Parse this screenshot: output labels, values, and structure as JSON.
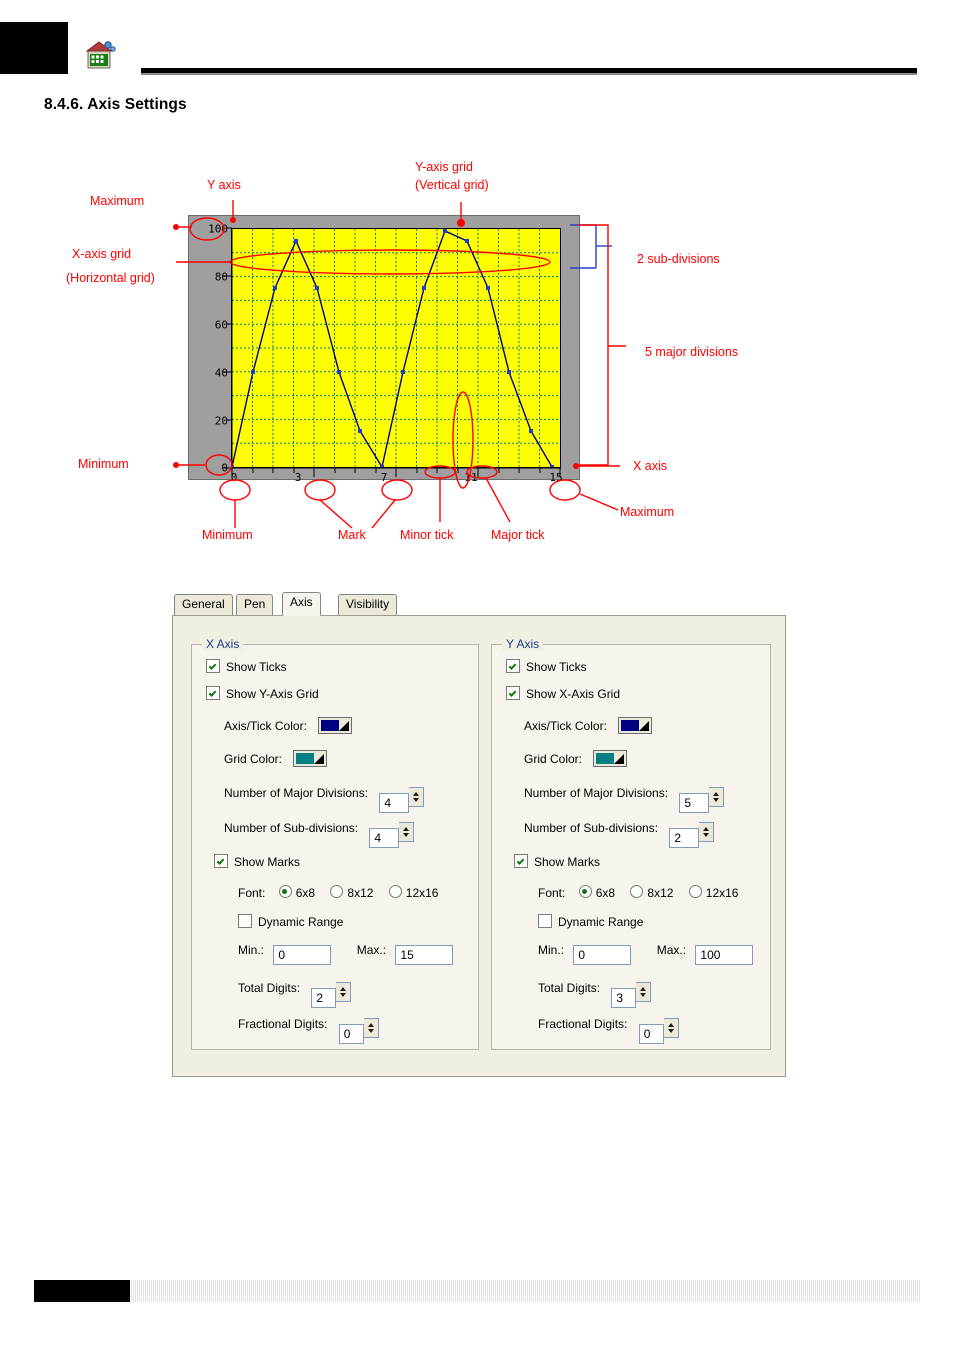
{
  "page": {
    "section_heading": "8.4.6. Axis Settings",
    "header_icon": "app-logo-icon"
  },
  "diagram": {
    "annotations": {
      "maximum_y": "Maximum",
      "minimum_y": "Minimum",
      "y_axis": "Y axis",
      "x_axis": "X axis",
      "maximum_x": "Maximum",
      "minimum_x": "Minimum",
      "x_axis_grid": "X-axis grid\n(Horizontal grid)",
      "x_axis_grid_l1": "X-axis grid",
      "x_axis_grid_l2": "(Horizontal grid)",
      "y_axis_grid_l1": "Y-axis grid",
      "y_axis_grid_l2": "(Vertical grid)",
      "sub_divisions": "2 sub-divisions",
      "major_divisions": "5 major divisions",
      "mark": "Mark",
      "minor_tick": "Minor tick",
      "major_tick": "Major tick"
    },
    "chart_data": {
      "type": "line",
      "title": "",
      "xlabel": "",
      "ylabel": "",
      "y_ticks": [
        "0",
        "20",
        "40",
        "60",
        "80",
        "100"
      ],
      "x_ticks": [
        "0",
        "3",
        "7",
        "11",
        "15"
      ],
      "xlim": [
        0,
        15
      ],
      "ylim": [
        0,
        100
      ],
      "plot_bg_color": "#ffff00",
      "grid_color": "#008080",
      "series_color": "#000080",
      "x": [
        0,
        1,
        2,
        3,
        4,
        5,
        6,
        7,
        8,
        9,
        10,
        11,
        12,
        13,
        14,
        15
      ],
      "values": [
        0,
        40,
        75,
        95,
        75,
        40,
        15,
        0,
        40,
        75,
        100,
        95,
        75,
        40,
        15,
        0
      ]
    }
  },
  "dialog": {
    "tabs": [
      {
        "label": "General",
        "active": false
      },
      {
        "label": "Pen",
        "active": false
      },
      {
        "label": "Axis",
        "active": true
      },
      {
        "label": "Visibility",
        "active": false
      }
    ],
    "x_axis": {
      "group_title": "X Axis",
      "show_ticks_label": "Show Ticks",
      "show_ticks_checked": true,
      "show_grid_label": "Show Y-Axis Grid",
      "show_grid_checked": true,
      "axis_tick_color_label": "Axis/Tick Color:",
      "axis_tick_color": "#000080",
      "grid_color_label": "Grid Color:",
      "grid_color": "#008080",
      "major_divisions_label": "Number of Major Divisions:",
      "major_divisions_value": "4",
      "sub_divisions_label": "Number of Sub-divisions:",
      "sub_divisions_value": "4",
      "show_marks_label": "Show Marks",
      "show_marks_checked": true,
      "font_label": "Font:",
      "font_options": [
        "6x8",
        "8x12",
        "12x16"
      ],
      "font_selected": "6x8",
      "dynamic_range_label": "Dynamic Range",
      "dynamic_range_checked": false,
      "min_label": "Min.:",
      "min_value": "0",
      "max_label": "Max.:",
      "max_value": "15",
      "total_digits_label": "Total Digits:",
      "total_digits_value": "2",
      "fractional_digits_label": "Fractional Digits:",
      "fractional_digits_value": "0"
    },
    "y_axis": {
      "group_title": "Y Axis",
      "show_ticks_label": "Show Ticks",
      "show_ticks_checked": true,
      "show_grid_label": "Show X-Axis Grid",
      "show_grid_checked": true,
      "axis_tick_color_label": "Axis/Tick Color:",
      "axis_tick_color": "#000080",
      "grid_color_label": "Grid Color:",
      "grid_color": "#008080",
      "major_divisions_label": "Number of Major Divisions:",
      "major_divisions_value": "5",
      "sub_divisions_label": "Number of Sub-divisions:",
      "sub_divisions_value": "2",
      "show_marks_label": "Show Marks",
      "show_marks_checked": true,
      "font_label": "Font:",
      "font_options": [
        "6x8",
        "8x12",
        "12x16"
      ],
      "font_selected": "6x8",
      "dynamic_range_label": "Dynamic Range",
      "dynamic_range_checked": false,
      "min_label": "Min.:",
      "min_value": "0",
      "max_label": "Max.:",
      "max_value": "100",
      "total_digits_label": "Total Digits:",
      "total_digits_value": "3",
      "fractional_digits_label": "Fractional Digits:",
      "fractional_digits_value": "0"
    }
  }
}
